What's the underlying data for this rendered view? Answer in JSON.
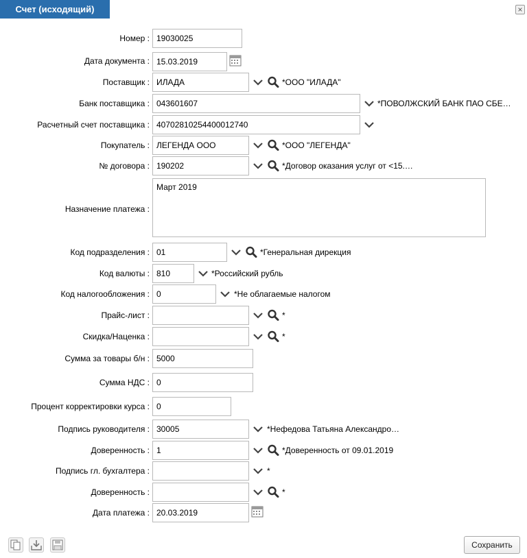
{
  "window": {
    "title": "Счет (исходящий)",
    "close_symbol": "×"
  },
  "fields": {
    "number": {
      "label": "Номер :",
      "value": "19030025"
    },
    "doc_date": {
      "label": "Дата документа :",
      "value": "15.03.2019"
    },
    "supplier": {
      "label": "Поставщик :",
      "value": "ИЛАДА",
      "description": "*ООО \"ИЛАДА\""
    },
    "supplier_bank": {
      "label": "Банк поставщика :",
      "value": "043601607",
      "description": "*ПОВОЛЖСКИЙ БАНК ПАО СБЕ…"
    },
    "supplier_account": {
      "label": "Расчетный счет поставщика :",
      "value": "40702810254400012740"
    },
    "buyer": {
      "label": "Покупатель :",
      "value": "ЛЕГЕНДА ООО",
      "description": "*ООО \"ЛЕГЕНДА\""
    },
    "contract": {
      "label": "№ договора :",
      "value": "190202",
      "description": "*Договор оказания услуг от <15.…"
    },
    "purpose": {
      "label": "Назначение платежа :",
      "value": "Март 2019"
    },
    "division_code": {
      "label": "Код подразделения :",
      "value": "01",
      "description": "*Генеральная дирекция"
    },
    "currency_code": {
      "label": "Код валюты :",
      "value": "810",
      "description": "*Российский рубль"
    },
    "tax_code": {
      "label": "Код налогообложения :",
      "value": "0",
      "description": "*Не облагаемые налогом"
    },
    "price_list": {
      "label": "Прайс-лист :",
      "value": "",
      "description": "*"
    },
    "discount": {
      "label": "Скидка/Наценка :",
      "value": "",
      "description": "*"
    },
    "goods_sum": {
      "label": "Сумма за товары б/н :",
      "value": "5000"
    },
    "vat_sum": {
      "label": "Сумма НДС :",
      "value": "0"
    },
    "rate_correction": {
      "label": "Процент корректировки курса :",
      "value": "0"
    },
    "head_signature": {
      "label": "Подпись руководителя :",
      "value": "30005",
      "description": "*Нефедова Татьяна Александро…"
    },
    "head_proxy": {
      "label": "Доверенность :",
      "value": "1",
      "description": "*Доверенность от 09.01.2019"
    },
    "accountant_signature": {
      "label": "Подпись гл. бухгалтера :",
      "value": "",
      "description": "*"
    },
    "accountant_proxy": {
      "label": "Доверенность :",
      "value": "",
      "description": "*"
    },
    "payment_date": {
      "label": "Дата платежа :",
      "value": "20.03.2019"
    }
  },
  "footer": {
    "save_label": "Сохранить"
  },
  "icons": {
    "dropdown": "chevron-down-icon",
    "lookup": "search-icon",
    "calendar": "calendar-icon",
    "copy": "copy-icon",
    "import": "download-icon",
    "save": "floppy-disk-icon",
    "close": "close-icon"
  },
  "colors": {
    "title_bar": "#2a6ead",
    "border": "#b9b9b9"
  }
}
